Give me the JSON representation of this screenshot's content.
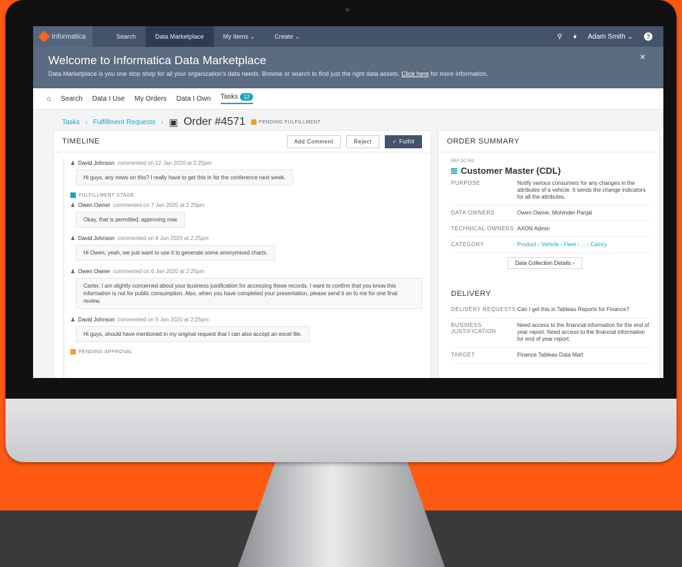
{
  "nav": {
    "brand": "Informatica",
    "links": [
      "Search",
      "Data Marketplace",
      "My Items ⌄",
      "Create ⌄"
    ],
    "user": "Adam Smith ⌄"
  },
  "banner": {
    "title": "Welcome to Informatica Data Marketplace",
    "text": "Data Marketplace is you one stop shop for all your organization's data needs. Browse or search to find just the right data assets.",
    "link": "Click here",
    "text_after": "for more information."
  },
  "subnav": {
    "tabs": [
      "Search",
      "Data I Use",
      "My Orders",
      "Data I Own",
      "Tasks"
    ],
    "tasks_count": "12"
  },
  "breadcrumb": {
    "tasks": "Tasks",
    "requests": "Fulfillment Requests",
    "order": "Order #4571",
    "status": "PENDING FULFILLMENT"
  },
  "timeline": {
    "title": "TIMELINE",
    "add_comment": "Add Comment",
    "reject": "Reject",
    "fulfill": "✓ Fulfill",
    "stage_fulfillment": "FULFILLMENT STAGE",
    "stage_pending": "PENDING APPROVAL",
    "entries": [
      {
        "name": "David Johnson",
        "when": "commented on 12 Jan 2020 at 2:25pm",
        "text": "Hi guys, any news on this? I really have to get this in for the conference next week."
      },
      {
        "name": "Owen Owner",
        "when": "commented on 7 Jan 2020 at 2:25pm",
        "text": "Okay, that is permitted, approving now"
      },
      {
        "name": "David Johnson",
        "when": "commented on 6 Jan 2020 at 2:25pm",
        "text": "Hi Owen, yeah, we just want to use it to generate some anonymised charts."
      },
      {
        "name": "Owen Owner",
        "when": "commented on 6 Jan 2020 at 2:25pm",
        "text": "Carter, I am slightly concerned about your business justification for accessing these records. I want to confirm that you know this information is not for public consumption. Also, when you have completed your presentation, please send it on to me for one final review."
      },
      {
        "name": "David Johnson",
        "when": "commented on 5 Jan 2020 at 2:25pm",
        "text": "Hi guys, should have mentioned in my original request that I can also accept an excel file."
      }
    ]
  },
  "summary": {
    "title": "ORDER SUMMARY",
    "ref": "REF DC 001",
    "dataset": "Customer Master (CDL)",
    "purpose_label": "PURPOSE",
    "purpose": "Notify various consumers for any changes in the attributes of a vehicle. It sends the change indicators for all the attributes.",
    "owners_label": "DATA OWNERS",
    "owners": "Owen Owner,   Mohinder Panjal",
    "tech_label": "TECHNICAL OWNERS",
    "tech": "AXON Admin",
    "category_label": "CATEGORY",
    "category": "Product › Vehicle › Fleet › ... › Camry",
    "details_button": "Data Collection Details  ›",
    "delivery_title": "DELIVERY",
    "delivery_label": "DELIVERY REQUESTS",
    "delivery": "Can I get this in Tableau Reports for Finance?",
    "business_label": "BUSINESS JUSTIFICATION",
    "business": "Need access to the financial information for the end of year report. Need access to the financial information for end of year report.",
    "target_label": "TARGET",
    "target": "Finance Tableau Data Mart"
  }
}
